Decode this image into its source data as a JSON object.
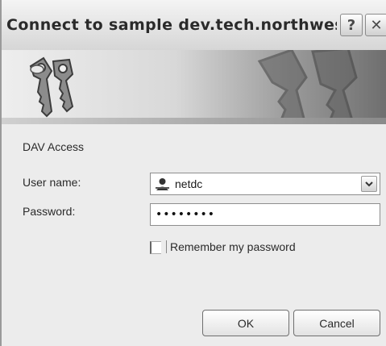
{
  "window": {
    "title": "Connect to sample dev.tech.northwester...",
    "help_button": "?",
    "close_button": "✕"
  },
  "banner": {
    "icon": "keys-icon",
    "watermark_icon": "keys-watermark"
  },
  "realm_text": "DAV Access",
  "username": {
    "label": "User name:",
    "value": "netdc",
    "icon": "user-icon",
    "dropdown_icon": "chevron-down-icon"
  },
  "password": {
    "label": "Password:",
    "masked_value": "••••••••"
  },
  "remember": {
    "label": "Remember my password",
    "checked": false
  },
  "buttons": {
    "ok": "OK",
    "cancel": "Cancel"
  }
}
